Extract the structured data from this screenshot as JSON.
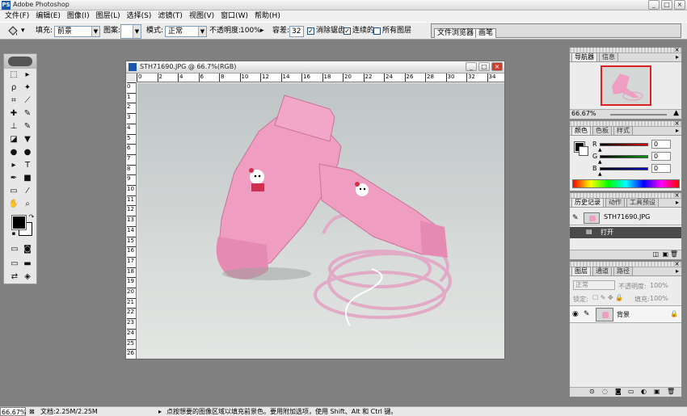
{
  "app": {
    "title": "Adobe Photoshop",
    "logo_letters": "PS"
  },
  "window_buttons": [
    "_",
    "□",
    "×"
  ],
  "menu": [
    "文件(F)",
    "编辑(E)",
    "图像(I)",
    "图层(L)",
    "选择(S)",
    "滤镜(T)",
    "视图(V)",
    "窗口(W)",
    "帮助(H)"
  ],
  "options": {
    "fill_label": "填充:",
    "fill_value": "前景",
    "pattern_label": "图案:",
    "mode_label": "模式:",
    "mode_value": "正常",
    "opacity_label": "不透明度:",
    "opacity_value": "100%",
    "tolerance_label": "容差:",
    "tolerance_value": "32",
    "antialias_label": "消除锯齿",
    "antialias_checked": true,
    "contiguous_label": "连续的",
    "contiguous_checked": true,
    "all_layers_label": "所有图层",
    "all_layers_checked": false
  },
  "well_tabs": [
    "文件浏览器",
    "画笔"
  ],
  "toolbox": {
    "icons": [
      "marquee-icon",
      "move-icon",
      "lasso-icon",
      "magic-wand-icon",
      "crop-icon",
      "slice-icon",
      "healing-brush-icon",
      "brush-icon",
      "clone-stamp-icon",
      "history-brush-icon",
      "eraser-icon",
      "paint-bucket-icon",
      "blur-icon",
      "dodge-icon",
      "path-selection-icon",
      "type-icon",
      "pen-icon",
      "shape-icon",
      "notes-icon",
      "eyedropper-icon",
      "hand-icon",
      "zoom-icon"
    ],
    "glyphs": [
      "⬚",
      "▸",
      "ρ",
      "✦",
      "⌗",
      "⟋",
      "✚",
      "✎",
      "⊥",
      "✎",
      "◪",
      "▼",
      "●",
      "●",
      "▸",
      "T",
      "✒",
      "■",
      "▭",
      "⁄",
      "✋",
      "⌕"
    ],
    "fg_color": "#000000",
    "bg_color": "#ffffff"
  },
  "document": {
    "title": "STH71690.JPG @ 66.7%(RGB)",
    "ruler_h": [
      "0",
      "2",
      "4",
      "6",
      "8",
      "10",
      "12",
      "14",
      "16",
      "18",
      "20",
      "22",
      "24",
      "26",
      "28",
      "30",
      "32",
      "34"
    ],
    "ruler_v": [
      "0",
      "1",
      "2",
      "3",
      "4",
      "5",
      "6",
      "7",
      "8",
      "9",
      "10",
      "11",
      "12",
      "13",
      "14",
      "15",
      "16",
      "17",
      "18",
      "19",
      "20",
      "21",
      "22",
      "23",
      "24",
      "25",
      "26"
    ],
    "image_colors": {
      "dryer": "#ef9ec2",
      "dryer_shadow": "#cc7096",
      "cord": "#e3aec8"
    }
  },
  "navigator": {
    "tabs": [
      "导航器",
      "信息"
    ],
    "zoom": "66.67%"
  },
  "color_panel": {
    "tabs": [
      "颜色",
      "色板",
      "样式"
    ],
    "channels": [
      {
        "label": "R",
        "value": "0",
        "color": "#e00000"
      },
      {
        "label": "G",
        "value": "0",
        "color": "#00a000"
      },
      {
        "label": "B",
        "value": "0",
        "color": "#0000d0"
      }
    ]
  },
  "history": {
    "tabs": [
      "历史记录",
      "动作",
      "工具预设"
    ],
    "snapshot": "STH71690.JPG",
    "items": [
      "打开"
    ]
  },
  "layers": {
    "tabs": [
      "图层",
      "通道",
      "路径"
    ],
    "blend_mode": "正常",
    "opacity_label": "不透明度:",
    "opacity_value": "100%",
    "lock_label": "锁定:",
    "fill_label": "填充:",
    "fill_value": "100%",
    "layer_name": "背景"
  },
  "status": {
    "zoom": "66.67%",
    "doc_info": "文档:2.25M/2.25M",
    "hint": "点按想要的图像区域以填充前景色。要用附加选项，使用 Shift、Alt 和 Ctrl 键。"
  }
}
